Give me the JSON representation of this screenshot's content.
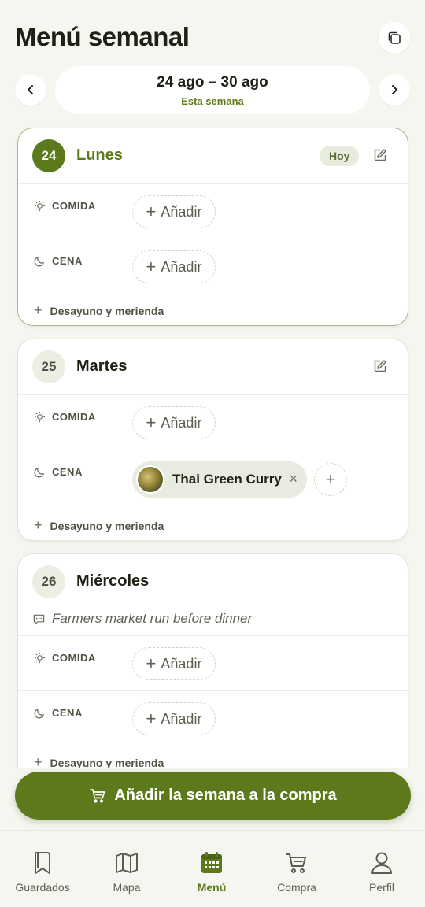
{
  "header": {
    "title": "Menú semanal"
  },
  "week": {
    "range": "24 ago – 30 ago",
    "subtitle": "Esta semana"
  },
  "days": [
    {
      "num": "24",
      "name": "Lunes",
      "badge": "Hoy",
      "meals": [
        {
          "label": "COMIDA",
          "add_label": "Añadir"
        },
        {
          "label": "CENA",
          "add_label": "Añadir"
        }
      ],
      "extras": "Desayuno y merienda"
    },
    {
      "num": "25",
      "name": "Martes",
      "meals": [
        {
          "label": "COMIDA",
          "add_label": "Añadir"
        },
        {
          "label": "CENA",
          "recipe": "Thai Green Curry",
          "remove": "×"
        }
      ],
      "extras": "Desayuno y merienda"
    },
    {
      "num": "26",
      "name": "Miércoles",
      "note": "Farmers market run before dinner",
      "meals": [
        {
          "label": "COMIDA",
          "add_label": "Añadir"
        },
        {
          "label": "CENA",
          "add_label": "Añadir"
        }
      ],
      "extras": "Desayuno y merienda"
    }
  ],
  "cta": {
    "label": "Añadir la semana a la compra",
    "icon": "cart-icon"
  },
  "nav": [
    {
      "label": "Guardados",
      "icon": "bookmark-icon"
    },
    {
      "label": "Mapa",
      "icon": "map-icon"
    },
    {
      "label": "Menú",
      "icon": "calendar-icon",
      "active": true
    },
    {
      "label": "Compra",
      "icon": "cart-icon"
    },
    {
      "label": "Perfil",
      "icon": "user-icon"
    }
  ],
  "colors": {
    "accent": "#5c7a1b",
    "background": "#f5f6f0",
    "card": "#ffffff"
  }
}
